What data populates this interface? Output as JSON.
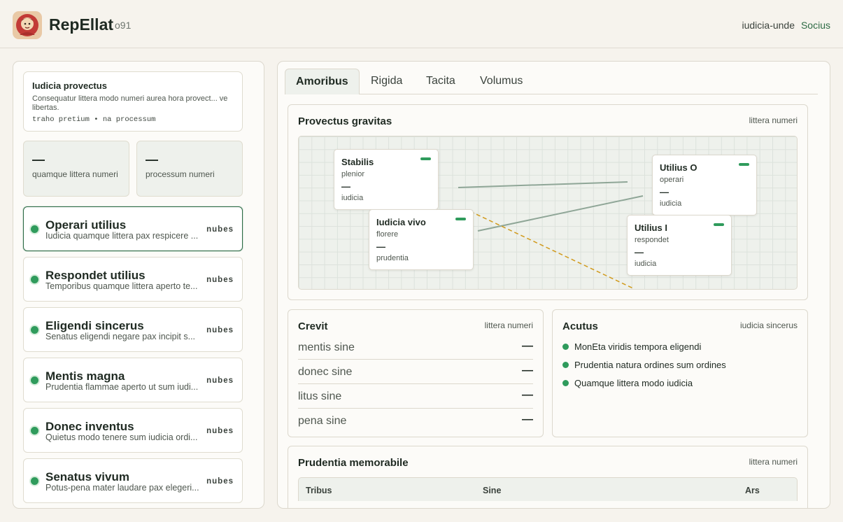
{
  "header": {
    "app_title": "RepEllat",
    "version": "o91",
    "user": "iudicia-unde",
    "link": "Socius"
  },
  "sidebar": {
    "intro": {
      "title": "Iudicia provectus",
      "desc": "Consequatur littera modo numeri aurea hora provect... ve libertas.",
      "meta": "traho pretium • na processum"
    },
    "stats": [
      {
        "value": "—",
        "label": "quamque littera numeri"
      },
      {
        "value": "—",
        "label": "processum numeri"
      }
    ],
    "items": [
      {
        "name": "Operari utilius",
        "sub": "Iudicia quamque littera pax respicere ...",
        "badge": "nubes"
      },
      {
        "name": "Respondet utilius",
        "sub": "Temporibus quamque littera aperto te...",
        "badge": "nubes"
      },
      {
        "name": "Eligendi sincerus",
        "sub": "Senatus eligendi negare pax incipit s...",
        "badge": "nubes"
      },
      {
        "name": "Mentis magna",
        "sub": "Prudentia flammae aperto ut sum iudi...",
        "badge": "nubes"
      },
      {
        "name": "Donec inventus",
        "sub": "Quietus modo tenere sum iudicia ordi...",
        "badge": "nubes"
      },
      {
        "name": "Senatus vivum",
        "sub": "Potus-pena mater laudare pax elegeri...",
        "badge": "nubes"
      }
    ]
  },
  "main": {
    "tabs": [
      {
        "label": "Amoribus"
      },
      {
        "label": "Rigida"
      },
      {
        "label": "Tacita"
      },
      {
        "label": "Volumus"
      }
    ],
    "graph_panel": {
      "title": "Provectus gravitas",
      "meta": "littera numeri",
      "nodes": [
        {
          "title": "Stabilis",
          "sub": "plenior",
          "value": "—",
          "foot": "iudicia"
        },
        {
          "title": "Iudicia vivo",
          "sub": "florere",
          "value": "—",
          "foot": "prudentia"
        },
        {
          "title": "Utilius O",
          "sub": "operari",
          "value": "—",
          "foot": "iudicia"
        },
        {
          "title": "Utilius I",
          "sub": "respondet",
          "value": "—",
          "foot": "iudicia"
        }
      ]
    },
    "crevit": {
      "title": "Crevit",
      "meta": "littera numeri",
      "rows": [
        {
          "key": "mentis sine",
          "value": "—"
        },
        {
          "key": "donec sine",
          "value": "—"
        },
        {
          "key": "litus sine",
          "value": "—"
        },
        {
          "key": "pena sine",
          "value": "—"
        }
      ]
    },
    "acutus": {
      "title": "Acutus",
      "meta": "iudicia sincerus",
      "items": [
        "MonEta viridis tempora eligendi",
        "Prudentia natura ordines sum ordines",
        "Quamque littera modo iudicia"
      ]
    },
    "prudentia": {
      "title": "Prudentia memorabile",
      "meta": "littera numeri",
      "columns": [
        "Tribus",
        "Sine",
        "Ars"
      ]
    }
  },
  "colors": {
    "accent": "#2e6b45",
    "status_dot": "#2f9b5c",
    "dashed_edge": "#d19a1c",
    "edge": "#8fa697"
  }
}
